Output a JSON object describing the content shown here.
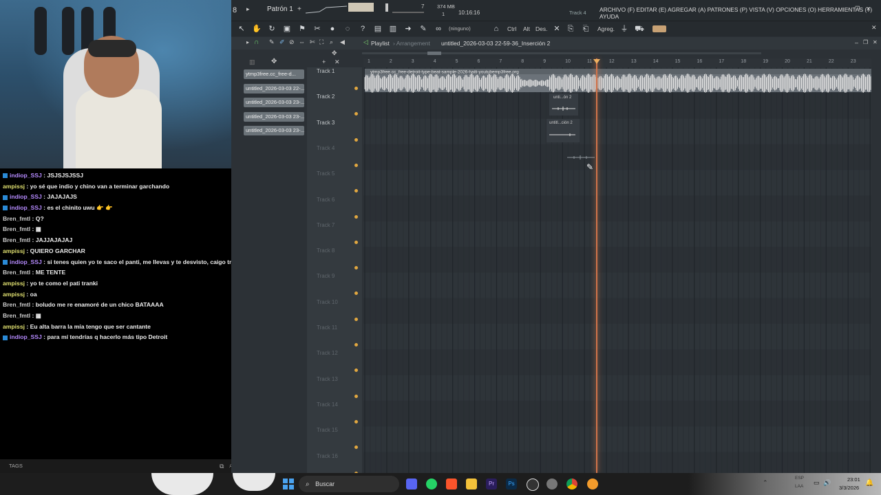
{
  "fl": {
    "pattern_label": "Patrón 1",
    "time": "10:16:16",
    "memory": "374 MB",
    "cpu_value": "7",
    "poly_value": "1",
    "track_hint": "Track 4",
    "menu": "ARCHIVO (F) EDITAR (E) AGREGAR (A) PATRONES (P) VISTA (V) OPCIONES (O) HERRAMIENTAS (T) AYUDA",
    "snap": "(ninguno)",
    "keys": [
      "Ctrl",
      "Alt",
      "Des."
    ],
    "agreg": "Agreg.",
    "playlist": "Playlist",
    "arrangement": "Arrangement",
    "arrangement_name": "untitled_2026-03-03 22-59-36_Inserción 2",
    "project_left": "8"
  },
  "browser_clips": [
    "ytmp3free.cc_free-d...",
    "untitled_2026-03-03 22-...",
    "untitled_2026-03-03 23-...",
    "untitled_2026-03-03 23-...",
    "untitled_2026-03-03 23-..."
  ],
  "tracks": [
    "Track 1",
    "Track 2",
    "Track 3",
    "Track 4",
    "Track 5",
    "Track 6",
    "Track 7",
    "Track 8",
    "Track 9",
    "Track 10",
    "Track 11",
    "Track 12",
    "Track 13",
    "Track 14",
    "Track 15",
    "Track 16"
  ],
  "ruler": [
    "1",
    "2",
    "3",
    "4",
    "5",
    "6",
    "7",
    "8",
    "9",
    "10",
    "11",
    "12",
    "13",
    "14",
    "15",
    "16",
    "17",
    "18",
    "19",
    "20",
    "21",
    "22",
    "23"
  ],
  "clips": {
    "main_label": "ytmp3free.cc_free-detroit-type-beat-sample-2026-haiti-youtubemp3free.org",
    "clip2_label": "unti...ón 2",
    "clip3_label": "untitl...ción 2"
  },
  "chat": [
    {
      "user": "indiop_SSJ",
      "color": "#b68bff",
      "badge": true,
      "msg": "JSJSJSJSSJ"
    },
    {
      "user": "ampissj",
      "color": "#e0e070",
      "badge": false,
      "msg": "yo sé que indio y chino van a terminar garchando"
    },
    {
      "user": "indiop_SSJ",
      "color": "#b68bff",
      "badge": true,
      "msg": "JAJAJAJS"
    },
    {
      "user": "indiop_SSJ",
      "color": "#b68bff",
      "badge": true,
      "msg": "es el chinito uwu 👉 👉"
    },
    {
      "user": "Bren_fmtl",
      "color": "#cccccc",
      "badge": false,
      "msg": "Q?"
    },
    {
      "user": "Bren_fmtl",
      "color": "#cccccc",
      "badge": false,
      "msg": "▦"
    },
    {
      "user": "Bren_fmtl",
      "color": "#cccccc",
      "badge": false,
      "msg": "JAJJAJAJAJ"
    },
    {
      "user": "ampissj",
      "color": "#e0e070",
      "badge": false,
      "msg": "QUIERO GARCHAR"
    },
    {
      "user": "indiop_SSJ",
      "color": "#b68bff",
      "badge": true,
      "msg": "si tenes quien yo te saco el panti, me llevas y te desvisto, caigo tranki"
    },
    {
      "user": "Bren_fmtl",
      "color": "#cccccc",
      "badge": false,
      "msg": "ME TENTE"
    },
    {
      "user": "ampissj",
      "color": "#e0e070",
      "badge": false,
      "msg": "yo te como el pati tranki"
    },
    {
      "user": "ampissj",
      "color": "#e0e070",
      "badge": false,
      "msg": "oa"
    },
    {
      "user": "Bren_fmtl",
      "color": "#cccccc",
      "badge": false,
      "msg": "boludo me re enamoré de un chico BATAAAA"
    },
    {
      "user": "Bren_fmtl",
      "color": "#cccccc",
      "badge": false,
      "msg": "▦"
    },
    {
      "user": "ampissj",
      "color": "#e0e070",
      "badge": false,
      "msg": "Eu alta barra la mía tengo que ser cantante"
    },
    {
      "user": "indiop_SSJ",
      "color": "#b68bff",
      "badge": true,
      "msg": "para mí tendrías q hacerlo más tipo Detroit"
    }
  ],
  "chat_footer": "TAGS",
  "taskbar": {
    "search": "Buscar",
    "time": "23:01",
    "date": "3/3/2026",
    "lang1": "ESP",
    "lang2": "LAA"
  },
  "icons": {
    "windows": "windows-icon",
    "search": "search-icon",
    "discord": "discord-icon",
    "whatsapp": "whatsapp-icon",
    "brave": "brave-icon",
    "folder": "folder-icon",
    "premiere": "premiere-icon",
    "photoshop": "photoshop-icon",
    "obs": "obs-icon",
    "settings": "settings-icon",
    "chrome": "chrome-icon",
    "flstudio": "fl-studio-icon"
  }
}
